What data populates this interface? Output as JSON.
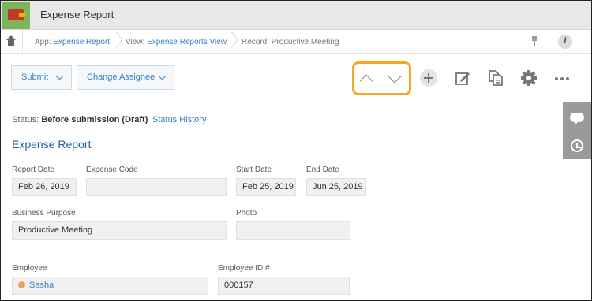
{
  "app": {
    "title": "Expense Report",
    "icon": "wallet-icon"
  },
  "breadcrumb": {
    "app_key": "App:",
    "app_value": "Expense Report",
    "view_key": "View:",
    "view_value": "Expense Reports View",
    "record_key": "Record:",
    "record_value": "Productive Meeting"
  },
  "toolbar": {
    "submit_label": "Submit",
    "change_assignee_label": "Change Assignee",
    "icons": [
      "prev-record-icon",
      "next-record-icon",
      "add-icon",
      "edit-icon",
      "duplicate-icon",
      "gear-icon",
      "more-icon"
    ]
  },
  "status": {
    "label": "Status:",
    "value": "Before submission (Draft)",
    "history_link": "Status History"
  },
  "record": {
    "title": "Expense Report",
    "fields": {
      "report_date": {
        "label": "Report Date",
        "value": "Feb 26, 2019"
      },
      "expense_code": {
        "label": "Expense Code",
        "value": ""
      },
      "start_date": {
        "label": "Start Date",
        "value": "Feb 25, 2019"
      },
      "end_date": {
        "label": "End Date",
        "value": "Jun 25, 2019"
      },
      "business_purpose": {
        "label": "Business Purpose",
        "value": "Productive Meeting"
      },
      "photo": {
        "label": "Photo",
        "value": ""
      },
      "employee": {
        "label": "Employee",
        "value": "Sasha"
      },
      "employee_id": {
        "label": "Employee ID #",
        "value": "000157"
      }
    }
  },
  "colors": {
    "accent": "#3a80c0",
    "highlight": "#f5a623",
    "title_blue": "#1f5f9f",
    "app_green": "#7cb55b"
  }
}
